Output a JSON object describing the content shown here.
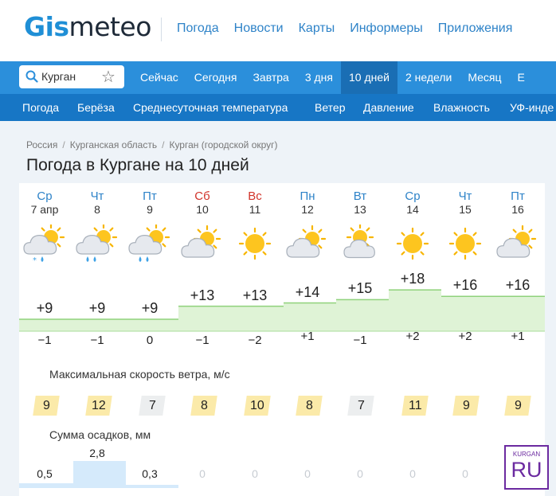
{
  "header": {
    "logo_gis": "Gis",
    "logo_meteo": "meteo",
    "nav": [
      "Погода",
      "Новости",
      "Карты",
      "Информеры",
      "Приложения"
    ]
  },
  "search": {
    "city": "Курган"
  },
  "periods": {
    "items": [
      "Сейчас",
      "Сегодня",
      "Завтра",
      "3 дня",
      "10 дней",
      "2 недели",
      "Месяц",
      "Е"
    ],
    "active": "10 дней"
  },
  "subnav": [
    "Погода",
    "Берёза",
    "Среднесуточная температура",
    "Ветер",
    "Давление",
    "Влажность",
    "УФ-инде"
  ],
  "breadcrumbs": [
    "Россия",
    "Курганская область",
    "Курган (городской округ)"
  ],
  "page_title": "Погода в Кургане на 10 дней",
  "days": [
    {
      "dow": "Ср",
      "date": "7 апр",
      "weekend": false,
      "icon": "partly-cloudy-snow-rain-icon",
      "tmax": "+9",
      "tmin": "−1",
      "wind": "9",
      "precip": "0,5"
    },
    {
      "dow": "Чт",
      "date": "8",
      "weekend": false,
      "icon": "partly-cloudy-rain-icon",
      "tmax": "+9",
      "tmin": "−1",
      "wind": "12",
      "precip": "2,8"
    },
    {
      "dow": "Пт",
      "date": "9",
      "weekend": false,
      "icon": "partly-cloudy-rain-icon",
      "tmax": "+9",
      "tmin": "0",
      "wind": "7",
      "precip": "0,3"
    },
    {
      "dow": "Сб",
      "date": "10",
      "weekend": true,
      "icon": "partly-cloudy-icon",
      "tmax": "+13",
      "tmin": "−1",
      "wind": "8",
      "precip": "0"
    },
    {
      "dow": "Вс",
      "date": "11",
      "weekend": true,
      "icon": "sun-icon",
      "tmax": "+13",
      "tmin": "−2",
      "wind": "10",
      "precip": "0"
    },
    {
      "dow": "Пн",
      "date": "12",
      "weekend": false,
      "icon": "partly-cloudy-icon",
      "tmax": "+14",
      "tmin": "+1",
      "wind": "8",
      "precip": "0"
    },
    {
      "dow": "Вт",
      "date": "13",
      "weekend": false,
      "icon": "mostly-cloudy-sun-icon",
      "tmax": "+15",
      "tmin": "−1",
      "wind": "7",
      "precip": "0"
    },
    {
      "dow": "Ср",
      "date": "14",
      "weekend": false,
      "icon": "sun-icon",
      "tmax": "+18",
      "tmin": "+2",
      "wind": "11",
      "precip": "0"
    },
    {
      "dow": "Чт",
      "date": "15",
      "weekend": false,
      "icon": "sun-icon",
      "tmax": "+16",
      "tmin": "+2",
      "wind": "9",
      "precip": "0"
    },
    {
      "dow": "Пт",
      "date": "16",
      "weekend": false,
      "icon": "partly-cloudy-icon",
      "tmax": "+16",
      "tmin": "+1",
      "wind": "9",
      "precip": "0"
    }
  ],
  "wind_label": "Максимальная скорость ветра, м/с",
  "precip_label": "Сумма осадков, мм",
  "temperature_values": {
    "tmax": [
      9,
      9,
      9,
      13,
      13,
      14,
      15,
      18,
      16,
      16
    ],
    "tmin": [
      -1,
      -1,
      0,
      -1,
      -2,
      1,
      -1,
      2,
      2,
      1
    ]
  },
  "precip_values": [
    0.5,
    2.8,
    0.3,
    0,
    0,
    0,
    0,
    0,
    0,
    0
  ],
  "colors": {
    "brand_blue": "#2b8fdb",
    "subnav_blue": "#1776c5",
    "link_blue": "#2e83c8",
    "weekend_red": "#d1342b",
    "temp_band": "#dff3d6",
    "wind_yellow": "#fbeaa9",
    "wind_gray": "#eceeef",
    "precip_bar": "#d5eafb"
  },
  "watermark": {
    "small": "KURGAN",
    "big": "RU"
  }
}
